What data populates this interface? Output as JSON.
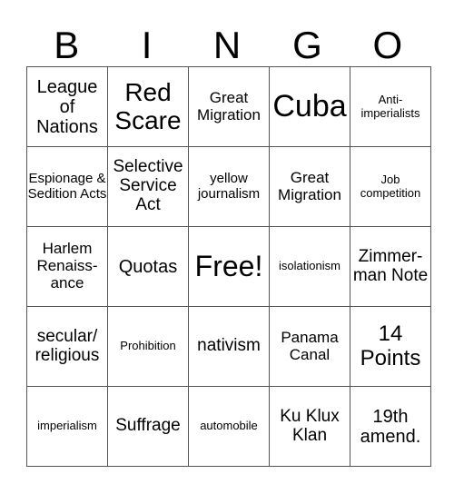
{
  "header": {
    "letters": [
      "B",
      "I",
      "N",
      "G",
      "O"
    ]
  },
  "grid": {
    "rows": [
      [
        "League of Nations",
        "Red Scare",
        "Great Migration",
        "Cuba",
        "Anti-imperialists"
      ],
      [
        "Espionage & Sedition Acts",
        "Selective Service Act",
        "yellow journalism",
        "Great Migration",
        "Job competition"
      ],
      [
        "Harlem Renaiss-ance",
        "Quotas",
        "Free!",
        "isolationism",
        "Zimmer-man Note"
      ],
      [
        "secular/ religious",
        "Prohibition",
        "nativism",
        "Panama Canal",
        "14 Points"
      ],
      [
        "imperialism",
        "Suffrage",
        "automobile",
        "Ku Klux Klan",
        "19th amend."
      ]
    ]
  },
  "cells": {
    "r0c0": "League of Nations",
    "r0c1": "Red Scare",
    "r0c2": "Great Migration",
    "r0c3": "Cuba",
    "r0c4": "Anti-imperialists",
    "r1c0": "Espionage & Sedition Acts",
    "r1c1": "Selective Service Act",
    "r1c2": "yellow journalism",
    "r1c3": "Great Migration",
    "r1c4": "Job competition",
    "r2c0": "Harlem Renaiss-ance",
    "r2c1": "Quotas",
    "r2c2": "Free!",
    "r2c3": "isolationism",
    "r2c4": "Zimmer-man Note",
    "r3c0": "secular/ religious",
    "r3c1": "Prohibition",
    "r3c2": "nativism",
    "r3c3": "Panama Canal",
    "r3c4": "14 Points",
    "r4c0": "imperialism",
    "r4c1": "Suffrage",
    "r4c2": "automobile",
    "r4c3": "Ku Klux Klan",
    "r4c4": "19th amend."
  },
  "colors": {
    "border": "#555555",
    "text": "#000000",
    "background": "#ffffff"
  }
}
